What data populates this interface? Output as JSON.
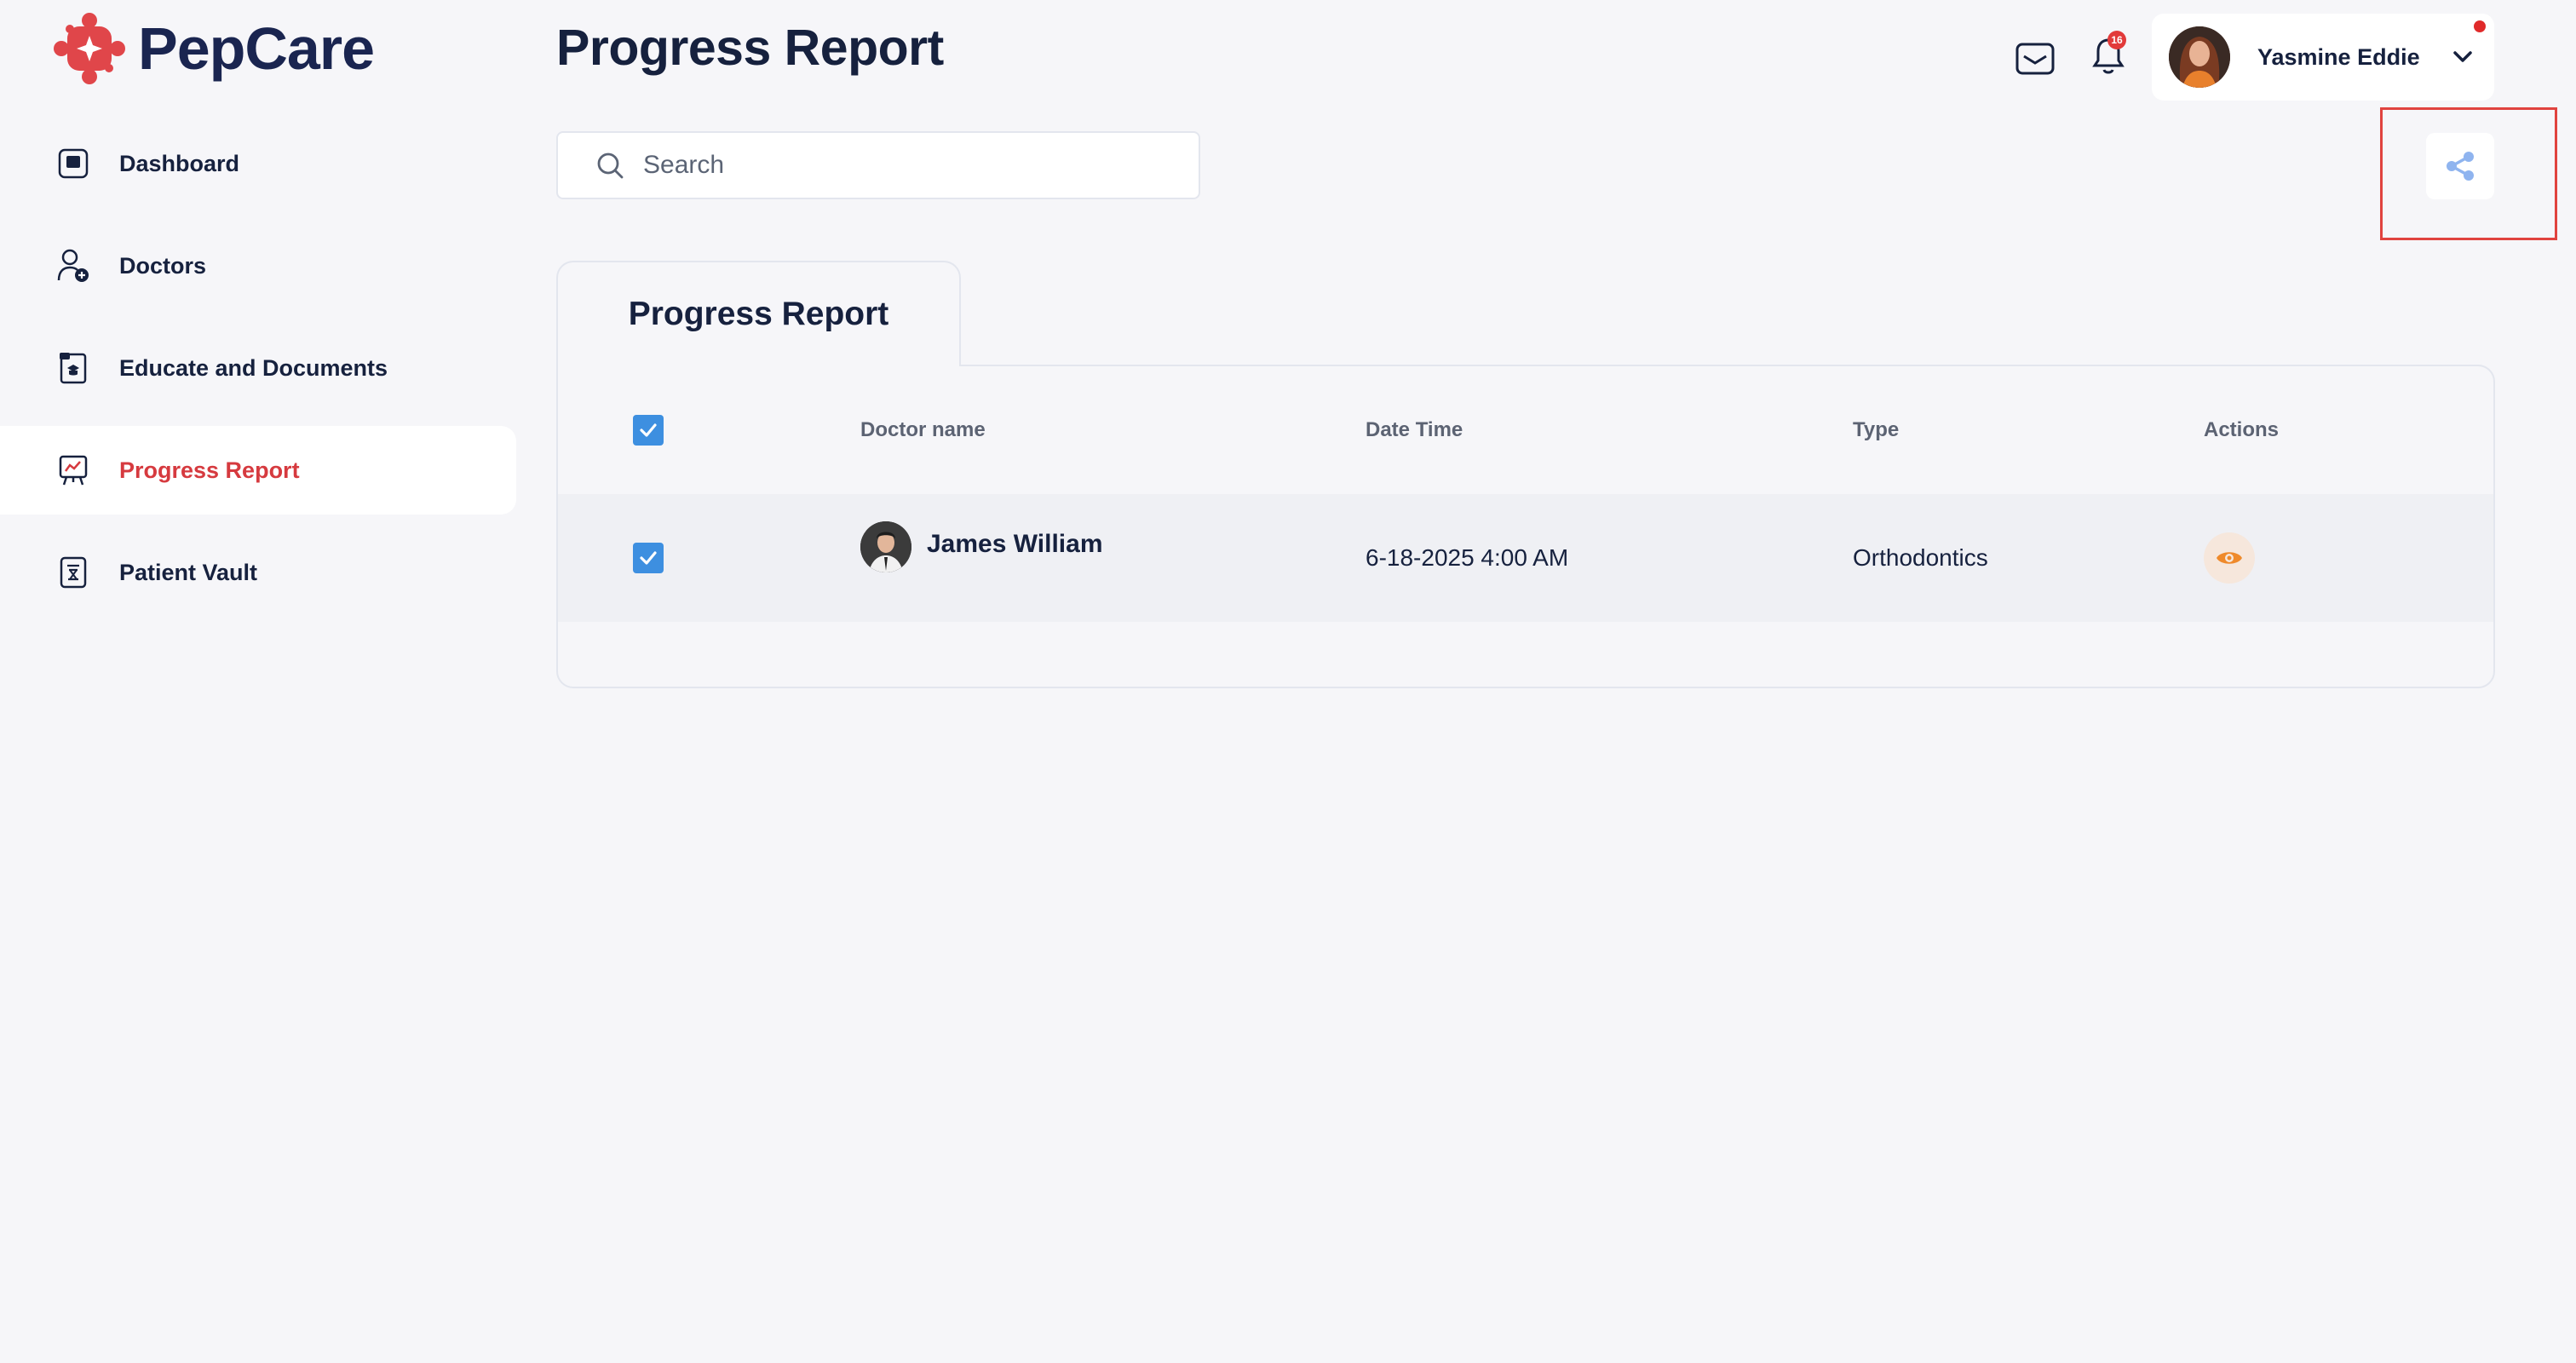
{
  "brand": {
    "name": "PepCare",
    "color": "#e0464a",
    "dark": "#1a2550"
  },
  "header": {
    "title": "Progress Report",
    "notification_count": "16",
    "user_name": "Yasmine Eddie"
  },
  "sidebar": {
    "items": [
      {
        "label": "Dashboard",
        "icon": "dashboard-icon",
        "active": false
      },
      {
        "label": "Doctors",
        "icon": "doctor-add-icon",
        "active": false
      },
      {
        "label": "Educate and Documents",
        "icon": "document-icon",
        "active": false
      },
      {
        "label": "Progress Report",
        "icon": "chart-board-icon",
        "active": true
      },
      {
        "label": "Patient Vault",
        "icon": "vault-icon",
        "active": false
      }
    ]
  },
  "search": {
    "placeholder": "Search",
    "value": ""
  },
  "tab": {
    "label": "Progress Report"
  },
  "table": {
    "columns": [
      "Doctor name",
      "Date Time",
      "Type",
      "Actions"
    ],
    "rows": [
      {
        "doctor": "James William",
        "datetime": "6-18-2025 4:00 AM",
        "type": "Orthodontics",
        "checked": true
      }
    ]
  },
  "colors": {
    "accent": "#d63a3f",
    "checkbox": "#3d8fe0",
    "share": "#8fb4ef",
    "eye": "#ef8a2b"
  }
}
